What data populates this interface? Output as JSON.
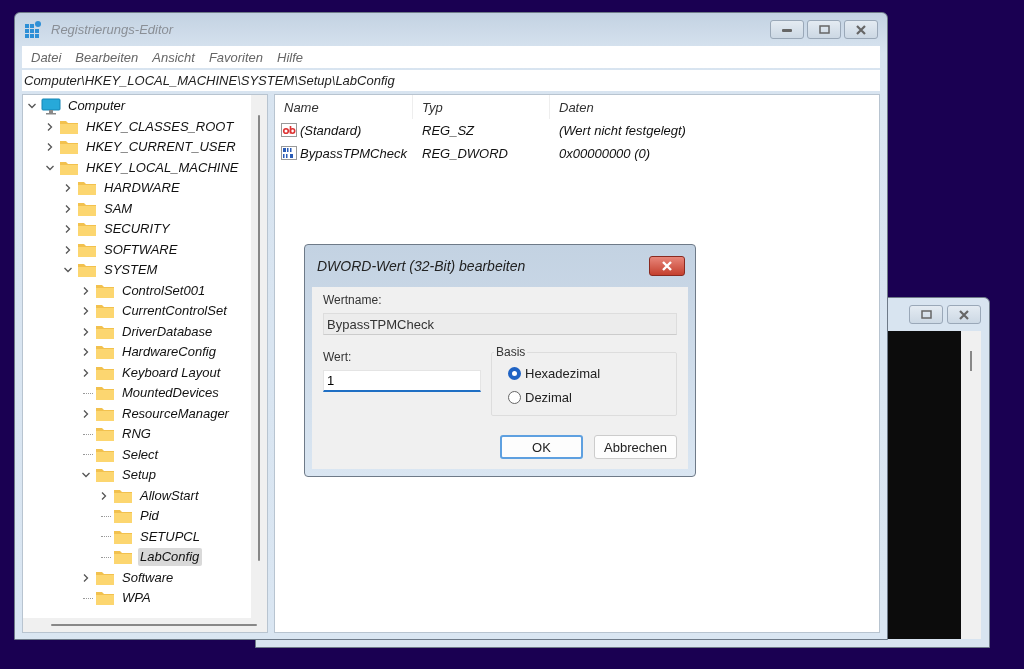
{
  "window": {
    "title": "Registrierungs-Editor"
  },
  "menu": [
    "Datei",
    "Bearbeiten",
    "Ansicht",
    "Favoriten",
    "Hilfe"
  ],
  "address": "Computer\\HKEY_LOCAL_MACHINE\\SYSTEM\\Setup\\LabConfig",
  "tree": [
    {
      "label": "Computer",
      "kind": "computer",
      "expanded": true,
      "selected": false,
      "children": [
        {
          "label": "HKEY_CLASSES_ROOT",
          "kind": "branch",
          "expanded": false,
          "selected": false
        },
        {
          "label": "HKEY_CURRENT_USER",
          "kind": "branch",
          "expanded": false,
          "selected": false
        },
        {
          "label": "HKEY_LOCAL_MACHINE",
          "kind": "branch",
          "expanded": true,
          "selected": false,
          "children": [
            {
              "label": "HARDWARE",
              "kind": "branch",
              "expanded": false,
              "selected": false
            },
            {
              "label": "SAM",
              "kind": "branch",
              "expanded": false,
              "selected": false
            },
            {
              "label": "SECURITY",
              "kind": "branch",
              "expanded": false,
              "selected": false
            },
            {
              "label": "SOFTWARE",
              "kind": "branch",
              "expanded": false,
              "selected": false
            },
            {
              "label": "SYSTEM",
              "kind": "branch",
              "expanded": true,
              "selected": false,
              "children": [
                {
                  "label": "ControlSet001",
                  "kind": "branch",
                  "expanded": false,
                  "selected": false
                },
                {
                  "label": "CurrentControlSet",
                  "kind": "branch",
                  "expanded": false,
                  "selected": false
                },
                {
                  "label": "DriverDatabase",
                  "kind": "branch",
                  "expanded": false,
                  "selected": false
                },
                {
                  "label": "HardwareConfig",
                  "kind": "branch",
                  "expanded": false,
                  "selected": false
                },
                {
                  "label": "Keyboard Layout",
                  "kind": "branch",
                  "expanded": false,
                  "selected": false
                },
                {
                  "label": "MountedDevices",
                  "kind": "leaf",
                  "selected": false
                },
                {
                  "label": "ResourceManager",
                  "kind": "branch",
                  "expanded": false,
                  "selected": false
                },
                {
                  "label": "RNG",
                  "kind": "leaf",
                  "selected": false
                },
                {
                  "label": "Select",
                  "kind": "leaf",
                  "selected": false
                },
                {
                  "label": "Setup",
                  "kind": "branch",
                  "expanded": true,
                  "selected": false,
                  "children": [
                    {
                      "label": "AllowStart",
                      "kind": "branch",
                      "expanded": false,
                      "selected": false
                    },
                    {
                      "label": "Pid",
                      "kind": "leaf",
                      "selected": false
                    },
                    {
                      "label": "SETUPCL",
                      "kind": "leaf",
                      "selected": false
                    },
                    {
                      "label": "LabConfig",
                      "kind": "leaf",
                      "selected": true
                    }
                  ]
                },
                {
                  "label": "Software",
                  "kind": "branch",
                  "expanded": false,
                  "selected": false
                },
                {
                  "label": "WPA",
                  "kind": "leaf",
                  "selected": false
                }
              ]
            }
          ]
        }
      ]
    }
  ],
  "values": {
    "columns": [
      "Name",
      "Typ",
      "Daten"
    ],
    "rows": [
      {
        "kind": "string",
        "name": "(Standard)",
        "type": "REG_SZ",
        "data": "(Wert nicht festgelegt)"
      },
      {
        "kind": "binary",
        "name": "BypassTPMCheck",
        "type": "REG_DWORD",
        "data": "0x00000000 (0)"
      }
    ]
  },
  "dialog": {
    "title": "DWORD-Wert (32-Bit) bearbeiten",
    "name_label": "Wertname:",
    "name_value": "BypassTPMCheck",
    "value_label": "Wert:",
    "value": "1",
    "base_label": "Basis",
    "bases": [
      {
        "label": "Hexadezimal",
        "selected": true
      },
      {
        "label": "Dezimal",
        "selected": false
      }
    ],
    "buttons": [
      {
        "label": "OK",
        "default": true
      },
      {
        "label": "Abbrechen",
        "default": false
      }
    ]
  }
}
